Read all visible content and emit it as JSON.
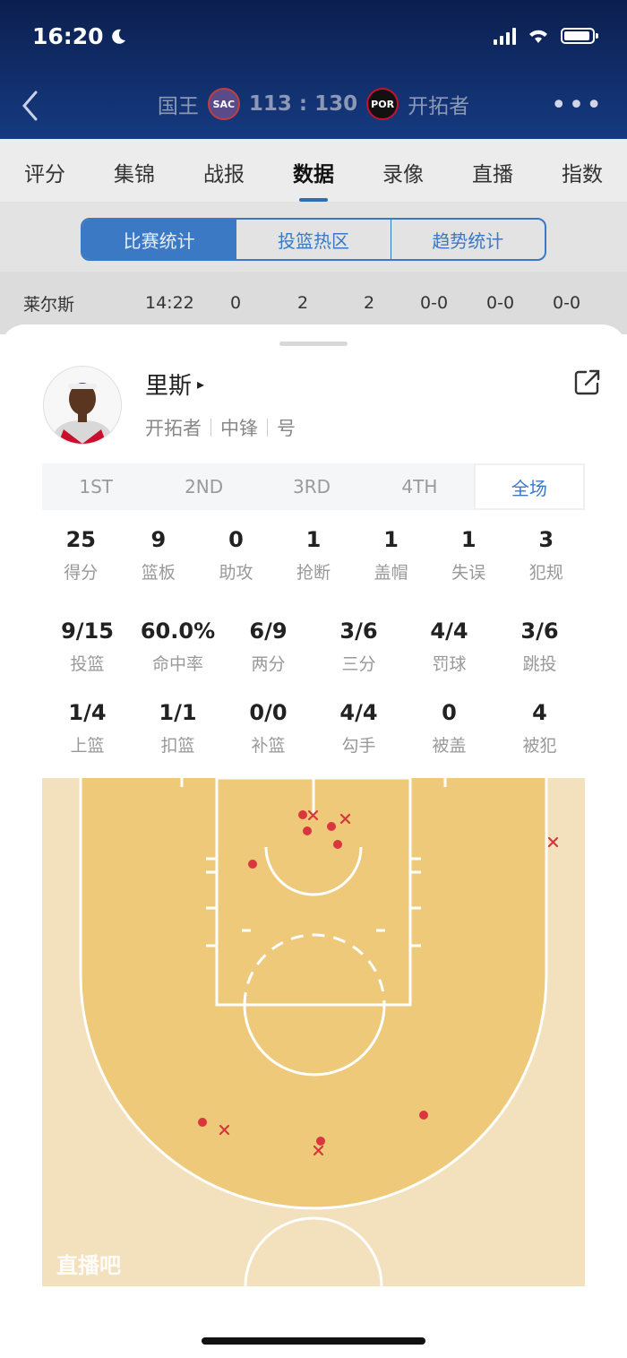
{
  "status_bar": {
    "time": "16:20"
  },
  "header": {
    "home_team": "国王",
    "home_abbr": "SAC",
    "score": "113 : 130",
    "away_abbr": "POR",
    "away_team": "开拓者",
    "more": "•••"
  },
  "tabs": [
    "评分",
    "集锦",
    "战报",
    "数据",
    "录像",
    "直播",
    "指数"
  ],
  "active_tab": "数据",
  "segment": [
    "比赛统计",
    "投篮热区",
    "趋势统计"
  ],
  "background_row": [
    "莱尔斯",
    "14:22",
    "0",
    "2",
    "2",
    "0-0",
    "0-0",
    "0-0"
  ],
  "player": {
    "name": "里斯",
    "arrow": "▸",
    "team": "开拓者",
    "position": "中锋",
    "number_label": "号"
  },
  "quarters": [
    "1ST",
    "2ND",
    "3RD",
    "4TH",
    "全场"
  ],
  "active_quarter": "全场",
  "stats_row1": [
    {
      "value": "25",
      "label": "得分"
    },
    {
      "value": "9",
      "label": "篮板"
    },
    {
      "value": "0",
      "label": "助攻"
    },
    {
      "value": "1",
      "label": "抢断"
    },
    {
      "value": "1",
      "label": "盖帽"
    },
    {
      "value": "1",
      "label": "失误"
    },
    {
      "value": "3",
      "label": "犯规"
    }
  ],
  "stats_row2": [
    {
      "value": "9/15",
      "label": "投篮"
    },
    {
      "value": "60.0%",
      "label": "命中率"
    },
    {
      "value": "6/9",
      "label": "两分"
    },
    {
      "value": "3/6",
      "label": "三分"
    },
    {
      "value": "4/4",
      "label": "罚球"
    },
    {
      "value": "3/6",
      "label": "跳投"
    }
  ],
  "stats_row3": [
    {
      "value": "1/4",
      "label": "上篮"
    },
    {
      "value": "1/1",
      "label": "扣篮"
    },
    {
      "value": "0/0",
      "label": "补篮"
    },
    {
      "value": "4/4",
      "label": "勾手"
    },
    {
      "value": "0",
      "label": "被盖"
    },
    {
      "value": "4",
      "label": "被犯"
    }
  ],
  "watermark": "直播吧",
  "colors": {
    "header": "#153a80",
    "accent": "#3c79c4",
    "court_inner": "#eec97a",
    "court_outer": "#f3e0bd",
    "made": "#d9363e",
    "missed": "#d9363e"
  }
}
